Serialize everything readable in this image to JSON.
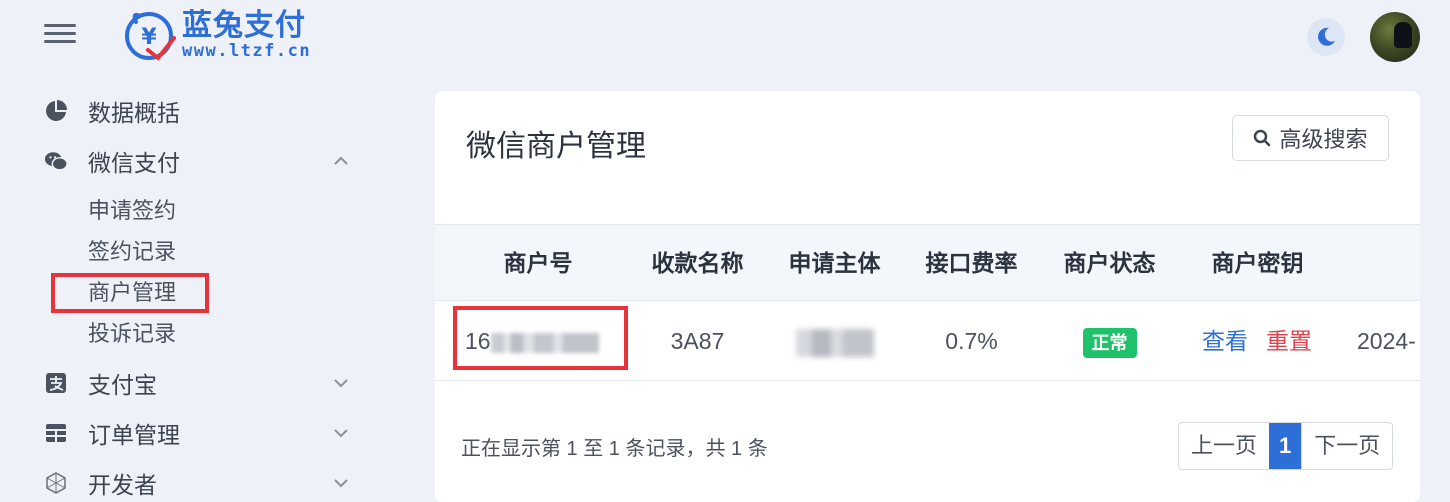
{
  "header": {
    "logo_cn": "蓝兔支付",
    "logo_url": "www.ltzf.cn",
    "accent": "#2d6fd6"
  },
  "sidebar": {
    "items": [
      {
        "label": "数据概括",
        "icon": "pie-chart-icon"
      },
      {
        "label": "微信支付",
        "icon": "wechat-icon",
        "expanded": true,
        "children": [
          "申请签约",
          "签约记录",
          "商户管理",
          "投诉记录"
        ]
      },
      {
        "label": "支付宝",
        "icon": "alipay-icon"
      },
      {
        "label": "订单管理",
        "icon": "table-icon"
      },
      {
        "label": "开发者",
        "icon": "hexagon-icon"
      }
    ]
  },
  "card": {
    "title": "微信商户管理",
    "search_label": "高级搜索",
    "columns": [
      "商户号",
      "收款名称",
      "申请主体",
      "接口费率",
      "商户状态",
      "商户密钥"
    ],
    "rows": [
      {
        "merchant_no": "16",
        "name": "3A87",
        "fee_rate": "0.7%",
        "status": "正常",
        "status_color": "#1fc26b",
        "view": "查看",
        "reset": "重置",
        "date": "2024-"
      }
    ],
    "footer": "正在显示第 1 至 1 条记录，共 1 条",
    "pager": {
      "prev": "上一页",
      "current": "1",
      "next": "下一页"
    }
  }
}
